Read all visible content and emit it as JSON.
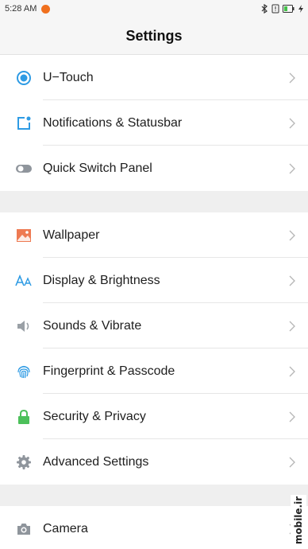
{
  "status_bar": {
    "time": "5:28 AM"
  },
  "header": {
    "title": "Settings"
  },
  "groups": [
    {
      "items": [
        {
          "label": "U−Touch",
          "icon": "utouch-icon"
        },
        {
          "label": "Notifications & Statusbar",
          "icon": "notification-icon"
        },
        {
          "label": "Quick Switch Panel",
          "icon": "toggle-icon"
        }
      ]
    },
    {
      "items": [
        {
          "label": "Wallpaper",
          "icon": "wallpaper-icon"
        },
        {
          "label": "Display & Brightness",
          "icon": "display-icon"
        },
        {
          "label": "Sounds & Vibrate",
          "icon": "speaker-icon"
        },
        {
          "label": "Fingerprint & Passcode",
          "icon": "fingerprint-icon"
        },
        {
          "label": "Security & Privacy",
          "icon": "lock-icon"
        },
        {
          "label": "Advanced Settings",
          "icon": "gear-icon"
        }
      ]
    },
    {
      "items": [
        {
          "label": "Camera",
          "icon": "camera-icon"
        }
      ]
    }
  ],
  "watermark": {
    "text": "mobile.ir"
  }
}
